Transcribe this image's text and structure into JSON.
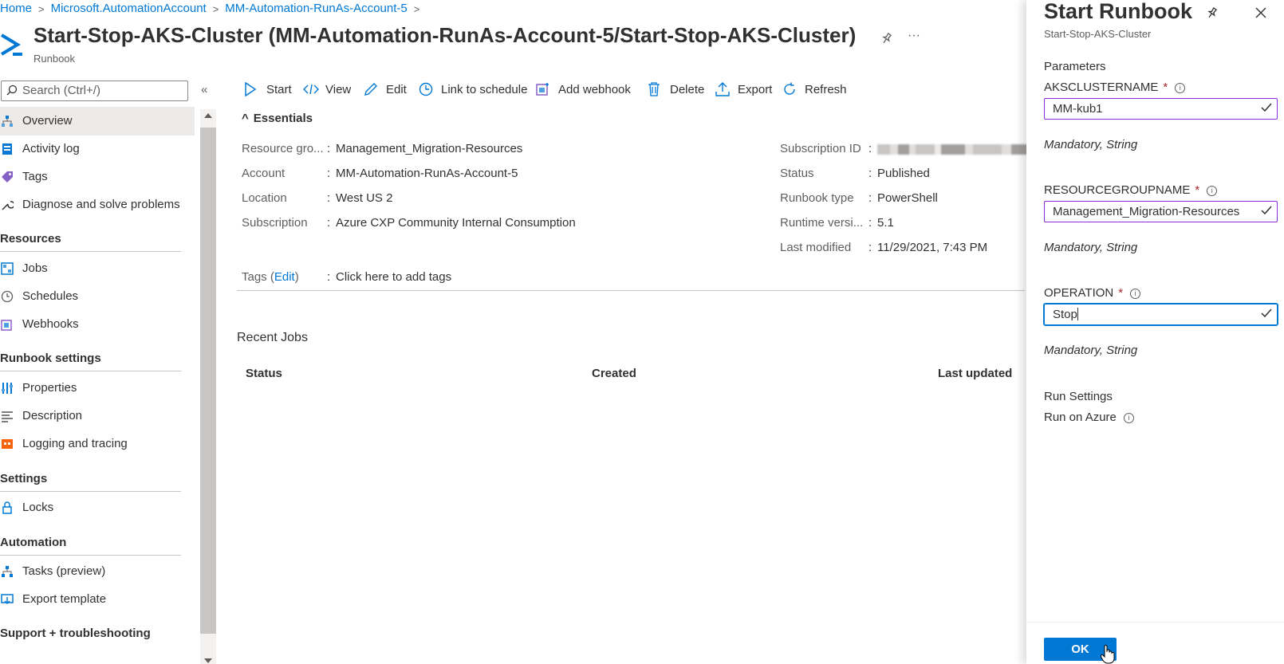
{
  "breadcrumb": [
    "Home",
    "Microsoft.AutomationAccount",
    "MM-Automation-RunAs-Account-5"
  ],
  "header": {
    "title": "Start-Stop-AKS-Cluster (MM-Automation-RunAs-Account-5/Start-Stop-AKS-Cluster)",
    "subtitle": "Runbook",
    "more": "···"
  },
  "search": {
    "placeholder": "Search (Ctrl+/)"
  },
  "collapse": "«",
  "sidebar": {
    "items": [
      {
        "label": "Overview",
        "icon": "overview-icon"
      },
      {
        "label": "Activity log",
        "icon": "activity-log-icon"
      },
      {
        "label": "Tags",
        "icon": "tag-icon"
      },
      {
        "label": "Diagnose and solve problems",
        "icon": "wrench-icon"
      }
    ],
    "sections": [
      {
        "heading": "Resources",
        "items": [
          {
            "label": "Jobs",
            "icon": "jobs-icon"
          },
          {
            "label": "Schedules",
            "icon": "clock-icon"
          },
          {
            "label": "Webhooks",
            "icon": "webhook-icon"
          }
        ]
      },
      {
        "heading": "Runbook settings",
        "items": [
          {
            "label": "Properties",
            "icon": "properties-icon"
          },
          {
            "label": "Description",
            "icon": "description-icon"
          },
          {
            "label": "Logging and tracing",
            "icon": "logging-icon"
          }
        ]
      },
      {
        "heading": "Settings",
        "items": [
          {
            "label": "Locks",
            "icon": "lock-icon"
          }
        ]
      },
      {
        "heading": "Automation",
        "items": [
          {
            "label": "Tasks (preview)",
            "icon": "tasks-icon"
          },
          {
            "label": "Export template",
            "icon": "export-template-icon"
          }
        ]
      },
      {
        "heading": "Support + troubleshooting",
        "items": []
      }
    ]
  },
  "toolbar": [
    "Start",
    "View",
    "Edit",
    "Link to schedule",
    "Add webhook",
    "Delete",
    "Export",
    "Refresh"
  ],
  "essentials": {
    "heading": "Essentials",
    "left": [
      {
        "key": "Resource gro...",
        "value": "Management_Migration-Resources",
        "link": true
      },
      {
        "key": "Account",
        "value": "MM-Automation-RunAs-Account-5",
        "link": false
      },
      {
        "key": "Location",
        "value": "West US 2",
        "link": false
      },
      {
        "key": "Subscription",
        "value": "Azure CXP Community Internal Consumption",
        "link": true
      }
    ],
    "right": [
      {
        "key": "Subscription ID",
        "value": "",
        "blurred": true
      },
      {
        "key": "Status",
        "value": "Published"
      },
      {
        "key": "Runbook type",
        "value": "PowerShell"
      },
      {
        "key": "Runtime versi...",
        "value": "5.1"
      },
      {
        "key": "Last modified",
        "value": "11/29/2021, 7:43 PM"
      }
    ],
    "tags_key": "Tags",
    "tags_edit": "Edit",
    "tags_value": "Click here to add tags"
  },
  "recent_jobs": {
    "title": "Recent Jobs",
    "columns": [
      "Status",
      "Created",
      "Last updated"
    ]
  },
  "panel": {
    "title": "Start Runbook",
    "subtitle": "Start-Stop-AKS-Cluster",
    "parameters_heading": "Parameters",
    "params": [
      {
        "name": "AKSCLUSTERNAME",
        "value": "MM-kub1",
        "note": "Mandatory, String"
      },
      {
        "name": "RESOURCEGROUPNAME",
        "value": "Management_Migration-Resources",
        "note": "Mandatory, String"
      },
      {
        "name": "OPERATION",
        "value": "Stop",
        "note": "Mandatory, String"
      }
    ],
    "required_mark": "*",
    "run_settings_heading": "Run Settings",
    "run_on": "Run on Azure",
    "ok_label": "OK"
  },
  "colors": {
    "accent": "#0078d4",
    "field_border": "#8a2be2",
    "required": "#a4262c"
  }
}
